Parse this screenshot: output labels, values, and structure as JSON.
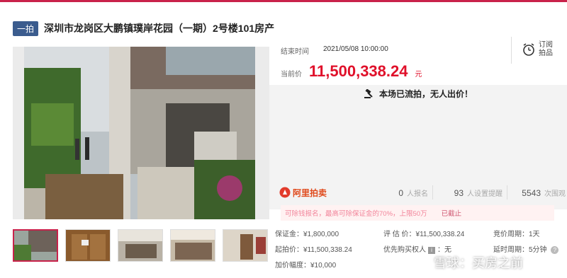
{
  "header": {
    "tag": "一拍",
    "title": "深圳市龙岗区大鹏镇璞岸花园（一期）2号楼101房产"
  },
  "auction": {
    "end_label": "结束时间",
    "end_time": "2021/05/08 10:00:00",
    "price_label": "当前价",
    "price": "11,500,338.24",
    "price_unit": "元",
    "subscribe_label": "订阅拍品",
    "status_text": "本场已流拍，无人出价！"
  },
  "stats": {
    "logo_text": "阿里拍卖",
    "signups_num": "0",
    "signups_label": "人报名",
    "reminders_num": "93",
    "reminders_label": "人设置提醒",
    "views_num": "5543",
    "views_label": "次围观"
  },
  "notice": {
    "text": "可除钱报名，最高可除保证金的70%，上限50万",
    "sub": "已截止"
  },
  "details": {
    "deposit": "保证金：¥1,800,000",
    "estimate": "评 估 价：¥11,500,338.24",
    "period": "竞价周期：1天",
    "start_price": "起拍价：¥11,500,338.24",
    "priority": "优先购买权人",
    "priority_value": "无",
    "delay": "延时周期：5分钟",
    "increment": "加价幅度：¥10,000"
  },
  "watermark": "雪球：买房之前",
  "colors": {
    "accent": "#c9224b",
    "price": "#e0102a",
    "tag": "#3b5c8e"
  },
  "icons": [
    "alarm-clock-icon",
    "gavel-icon",
    "zoom-icon",
    "help-icon"
  ]
}
